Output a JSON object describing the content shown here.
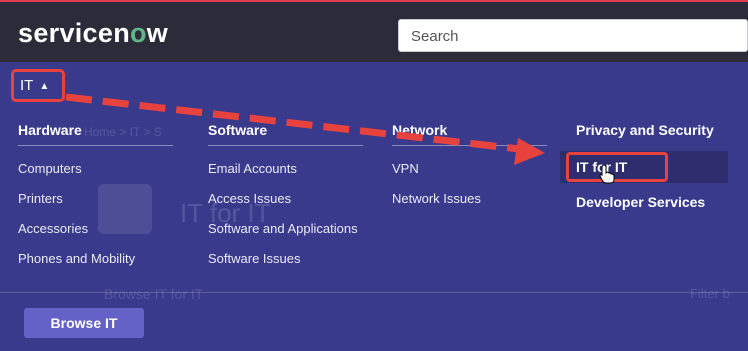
{
  "header": {
    "logo_main": "servicen",
    "logo_o": "o",
    "logo_end": "w",
    "search_placeholder": "Search"
  },
  "nav": {
    "menu_label": "IT",
    "menu_caret": "▲"
  },
  "background_ghost": {
    "breadcrumb": "Home > IT > S",
    "title": "IT for IT",
    "browse": "Browse IT for IT",
    "filter": "Filter b"
  },
  "menu": {
    "columns": [
      {
        "heading": "Hardware",
        "items": [
          "Computers",
          "Printers",
          "Accessories",
          "Phones and Mobility"
        ]
      },
      {
        "heading": "Software",
        "items": [
          "Email Accounts",
          "Access Issues",
          "Software and Applications",
          "Software Issues"
        ]
      },
      {
        "heading": "Network",
        "items": [
          "VPN",
          "Network Issues"
        ]
      }
    ],
    "sections": {
      "privacy": "Privacy and Security",
      "it_for_it": "IT for IT",
      "developer": "Developer Services"
    },
    "browse_button": "Browse IT"
  },
  "colors": {
    "header_bg": "#2b2b3a",
    "menu_bg": "#3a3a8c",
    "annotation_red": "#e8423e",
    "button_bg": "#6461c7",
    "logo_accent": "#5fb883"
  }
}
